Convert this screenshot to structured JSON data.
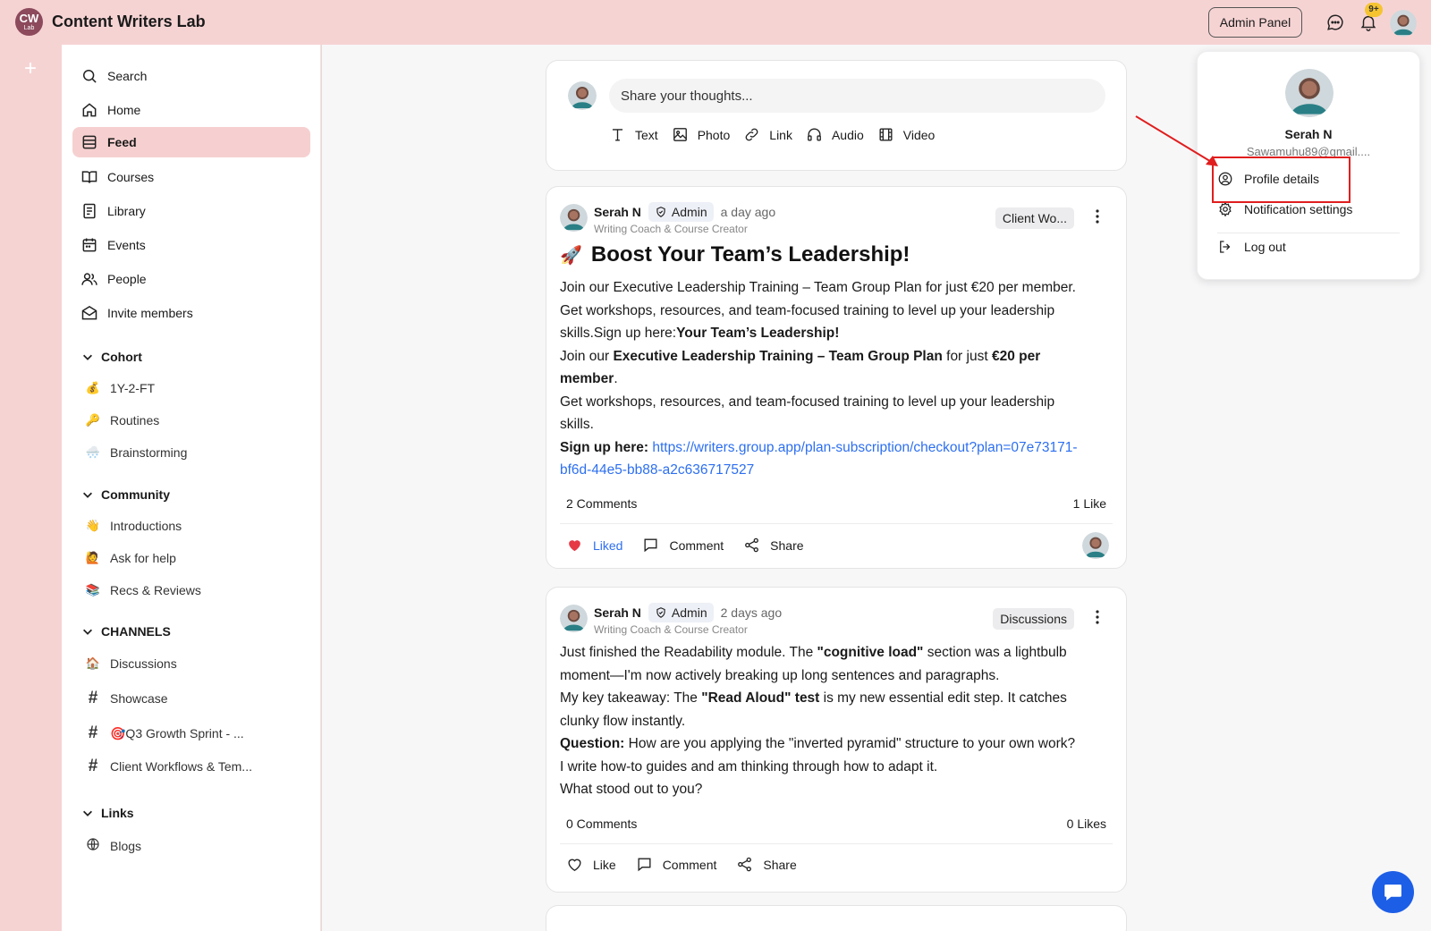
{
  "app": {
    "logo_text": "CW",
    "logo_sub": "Lab",
    "title": "Content Writers Lab"
  },
  "topbar": {
    "admin_label": "Admin Panel",
    "notif_badge": "9+"
  },
  "sidebar": {
    "nav": [
      {
        "label": "Search",
        "icon": "search-icon"
      },
      {
        "label": "Home",
        "icon": "home-icon"
      },
      {
        "label": "Feed",
        "icon": "feed-icon",
        "active": true
      },
      {
        "label": "Courses",
        "icon": "book-icon"
      },
      {
        "label": "Library",
        "icon": "library-icon"
      },
      {
        "label": "Events",
        "icon": "calendar-icon"
      },
      {
        "label": "People",
        "icon": "people-icon"
      },
      {
        "label": "Invite members",
        "icon": "mail-icon"
      }
    ],
    "cohort": {
      "title": "Cohort",
      "items": [
        {
          "emoji": "💰",
          "label": "1Y-2-FT"
        },
        {
          "emoji": "🔑",
          "label": "Routines"
        },
        {
          "emoji": "🌨️",
          "label": "Brainstorming"
        }
      ]
    },
    "community": {
      "title": "Community",
      "items": [
        {
          "emoji": "👋",
          "label": "Introductions"
        },
        {
          "emoji": "🙋",
          "label": "Ask for help"
        },
        {
          "emoji": "📚",
          "label": "Recs & Reviews"
        }
      ]
    },
    "channels": {
      "title": "CHANNELS",
      "items": [
        {
          "emoji": "🏠",
          "label": "Discussions"
        },
        {
          "hash": "#",
          "label": "Showcase"
        },
        {
          "hash": "#",
          "label": "🎯Q3 Growth Sprint - ..."
        },
        {
          "hash": "#",
          "label": "Client Workflows & Tem..."
        }
      ]
    },
    "links": {
      "title": "Links",
      "items": [
        {
          "label": "Blogs",
          "icon": "globe-icon"
        }
      ]
    }
  },
  "composer": {
    "placeholder": "Share your thoughts...",
    "actions": [
      "Text",
      "Photo",
      "Link",
      "Audio",
      "Video"
    ]
  },
  "posts": [
    {
      "author": "Serah N",
      "role": "Admin",
      "time": "a day ago",
      "subtitle": "Writing Coach & Course Creator",
      "channel": "Client Wo...",
      "title_emoji": "🚀",
      "title": "Boost Your Team’s Leadership!",
      "body": {
        "l1": "Join our Executive Leadership Training – Team Group Plan for just €20 per member.",
        "l2": "Get workshops, resources, and team-focused training to level up your leadership",
        "l3a": "skills.Sign up here:",
        "l3b": "Your Team’s Leadership!",
        "l4a": "Join our ",
        "l4b": "Executive Leadership Training – Team Group Plan",
        "l4c": " for just ",
        "l4d": "€20 per",
        "l5a": "member",
        "l5b": ".",
        "l6": "Get workshops, resources, and team-focused training to level up your leadership",
        "l7": "skills.",
        "l8a": "Sign up here:",
        "l8b": "https://writers.group.app/plan-subscription/checkout?plan=07e73171-",
        "l9": "bf6d-44e5-bb88-a2c636717527"
      },
      "comments": "2 Comments",
      "likes": "1 Like",
      "like_label": "Liked",
      "comment_label": "Comment",
      "share_label": "Share"
    },
    {
      "author": "Serah N",
      "role": "Admin",
      "time": "2 days ago",
      "subtitle": "Writing Coach & Course Creator",
      "channel": "Discussions",
      "body": {
        "l1a": "Just finished the Readability module. The ",
        "l1b": "\"cognitive load\"",
        "l1c": " section was a lightbulb",
        "l2": "moment—I'm now actively breaking up long sentences and paragraphs.",
        "l3a": "My key takeaway: The ",
        "l3b": "\"Read Aloud\" test",
        "l3c": " is my new essential edit step. It catches",
        "l4": "clunky flow instantly.",
        "l5a": "Question:",
        "l5b": " How are you applying the \"inverted pyramid\" structure to your own work?",
        "l6": "I write how-to guides and am thinking through how to adapt it.",
        "l7": "What stood out to you?"
      },
      "comments": "0 Comments",
      "likes": "0 Likes",
      "like_label": "Like",
      "comment_label": "Comment",
      "share_label": "Share"
    }
  ],
  "profile_menu": {
    "name": "Serah N",
    "email": "Sawamuhu89@gmail....",
    "items": [
      "Profile details",
      "Notification settings",
      "Log out"
    ]
  },
  "colors": {
    "brand": "#8c4a5c",
    "topbar_bg": "#f6d3d3",
    "active_nav": "#f6d0d0",
    "link": "#2d6ff0",
    "highlight": "#e01e1e",
    "fab": "#1d5ee6"
  }
}
